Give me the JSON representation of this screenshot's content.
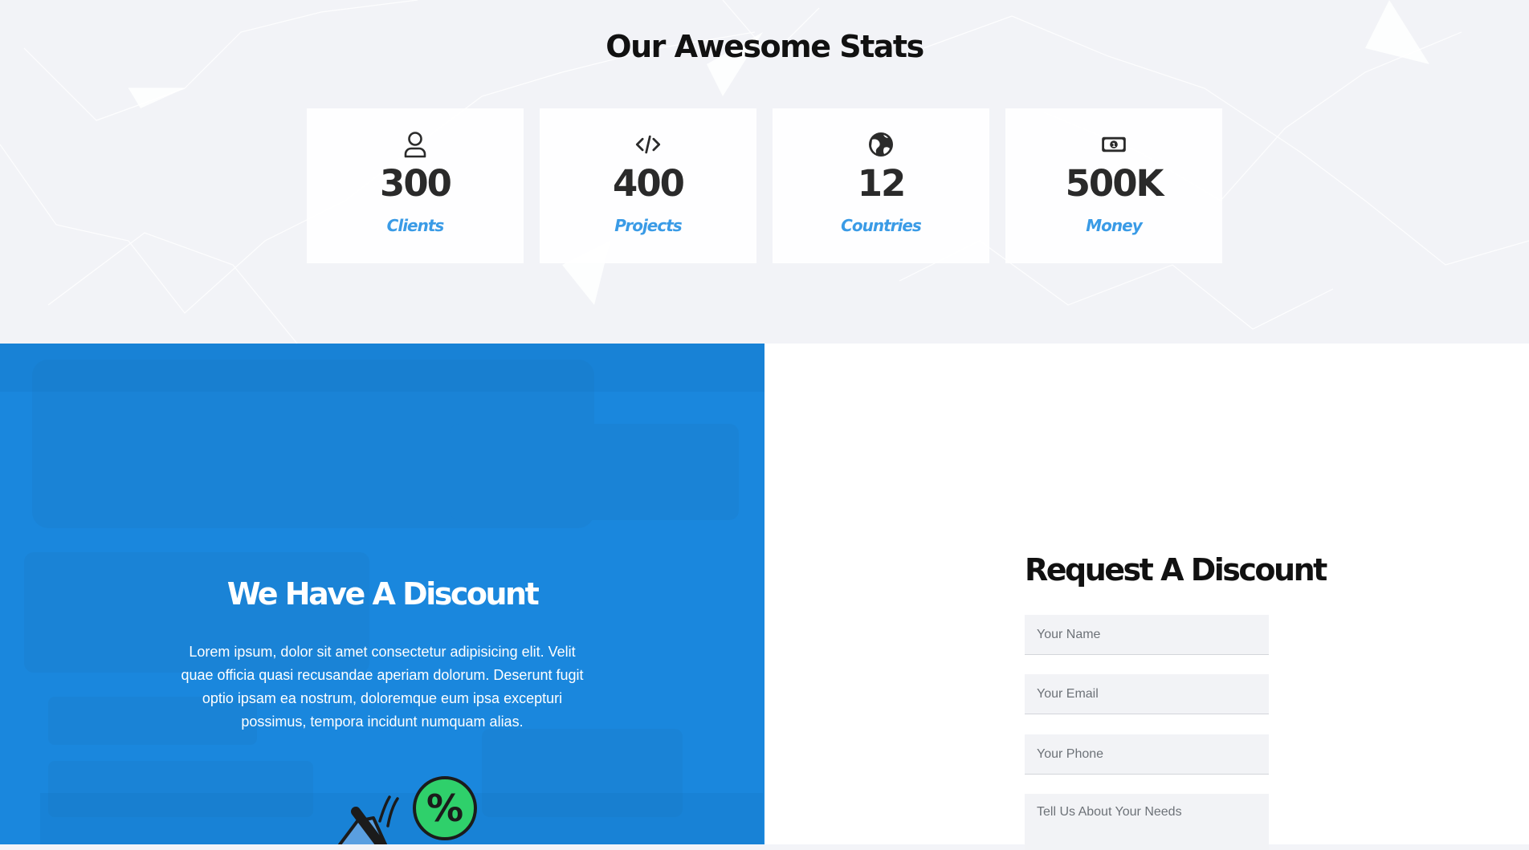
{
  "stats": {
    "title": "Our Awesome Stats",
    "items": [
      {
        "icon": "user-icon",
        "value": "300",
        "label": "Clients"
      },
      {
        "icon": "code-icon",
        "value": "400",
        "label": "Projects"
      },
      {
        "icon": "globe-icon",
        "value": "12",
        "label": "Countries"
      },
      {
        "icon": "money-bill-icon",
        "value": "500K",
        "label": "Money"
      }
    ]
  },
  "discount": {
    "title": "We Have A Discount",
    "text": "Lorem ipsum, dolor sit amet consectetur adipisicing elit. Velit quae officia quasi recusandae aperiam dolorum. Deserunt fugit optio ipsam ea nostrum, doloremque eum ipsa excepturi possimus, tempora incidunt numquam alias.",
    "illustration": "discount-percent-icon"
  },
  "request": {
    "title": "Request A Discount",
    "name_placeholder": "Your Name",
    "email_placeholder": "Your Email",
    "phone_placeholder": "Your Phone",
    "needs_placeholder": "Tell Us About Your Needs"
  },
  "colors": {
    "accent_blue": "#1a87dd",
    "label_blue": "#3a9be6",
    "percent_green": "#2fd06b"
  }
}
